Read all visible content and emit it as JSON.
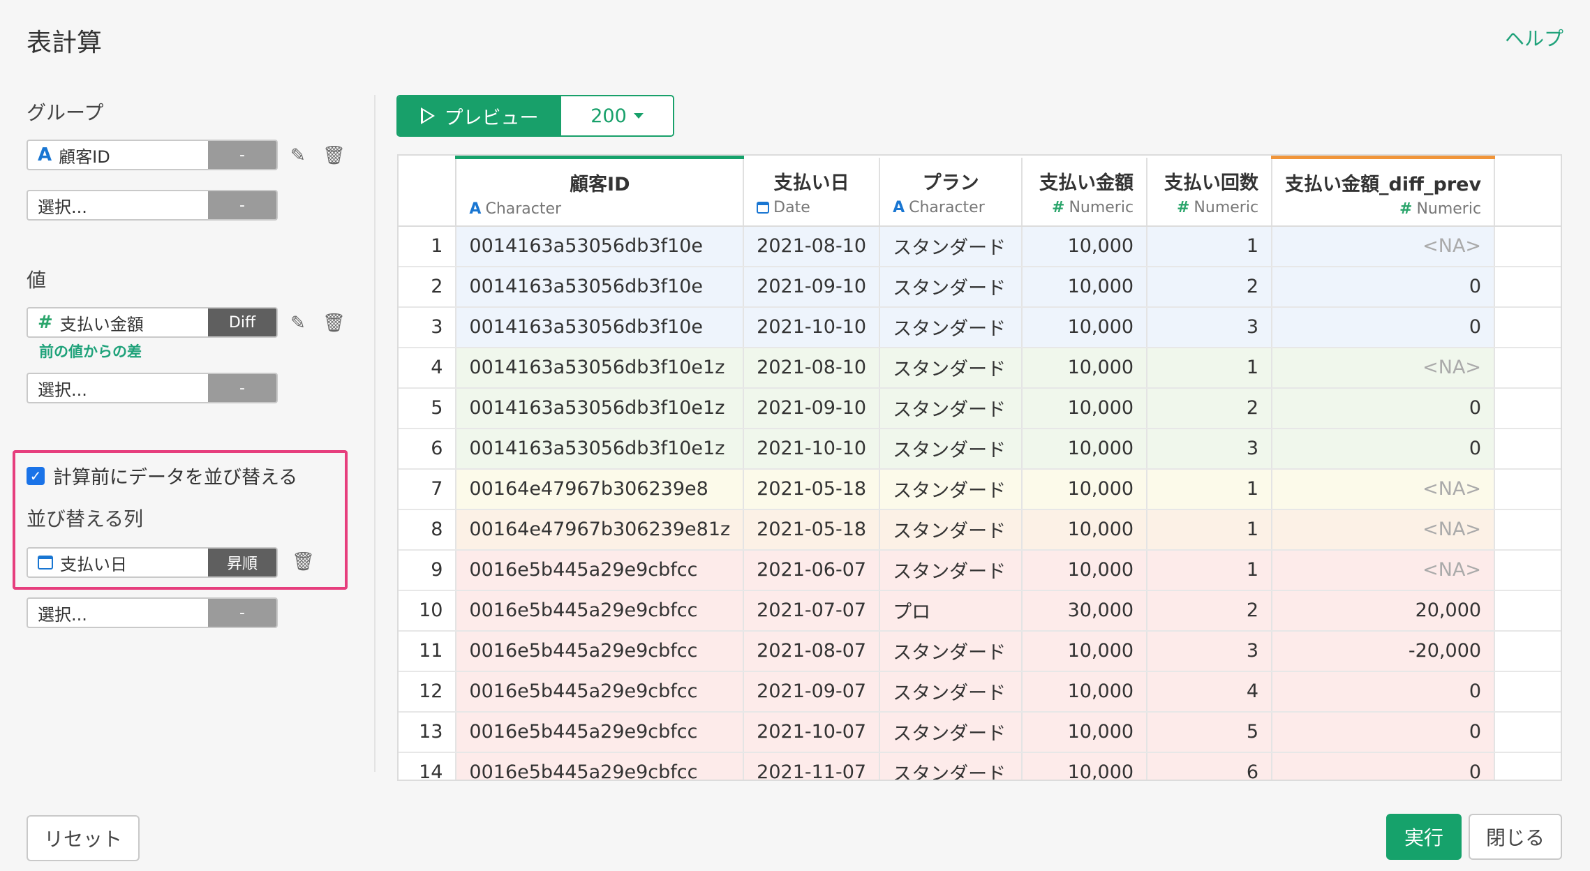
{
  "header": {
    "title": "表計算",
    "help_label": "ヘルプ"
  },
  "group": {
    "label": "グループ",
    "field1": {
      "value": "顧客ID",
      "button": "-"
    },
    "field2": {
      "value": "選択...",
      "button": "-"
    }
  },
  "value": {
    "label": "値",
    "field1": {
      "value": "支払い金額",
      "button": "Diff",
      "note": "前の値からの差"
    },
    "field2": {
      "value": "選択...",
      "button": "-"
    }
  },
  "sort": {
    "checkbox_label": "計算前にデータを並び替える",
    "checked": true,
    "columns_label": "並び替える列",
    "field1": {
      "value": "支払い日",
      "button": "昇順"
    },
    "field2": {
      "value": "選択...",
      "button": "-"
    }
  },
  "preview": {
    "button_label": "プレビュー",
    "rows_value": "200"
  },
  "table": {
    "columns": [
      {
        "name": "顧客ID",
        "type": "Character",
        "type_icon": "A"
      },
      {
        "name": "支払い日",
        "type": "Date",
        "type_icon": "calendar"
      },
      {
        "name": "プラン",
        "type": "Character",
        "type_icon": "A"
      },
      {
        "name": "支払い金額",
        "type": "Numeric",
        "type_icon": "#"
      },
      {
        "name": "支払い回数",
        "type": "Numeric",
        "type_icon": "#"
      },
      {
        "name": "支払い金額_diff_prev",
        "type": "Numeric",
        "type_icon": "#"
      }
    ],
    "rows": [
      {
        "n": "1",
        "id": "0014163a53056db3f10e",
        "date": "2021-08-10",
        "plan": "スタンダード",
        "amount": "10,000",
        "count": "1",
        "diff": "<NA>",
        "group": 1
      },
      {
        "n": "2",
        "id": "0014163a53056db3f10e",
        "date": "2021-09-10",
        "plan": "スタンダード",
        "amount": "10,000",
        "count": "2",
        "diff": "0",
        "group": 1
      },
      {
        "n": "3",
        "id": "0014163a53056db3f10e",
        "date": "2021-10-10",
        "plan": "スタンダード",
        "amount": "10,000",
        "count": "3",
        "diff": "0",
        "group": 1
      },
      {
        "n": "4",
        "id": "0014163a53056db3f10e1z",
        "date": "2021-08-10",
        "plan": "スタンダード",
        "amount": "10,000",
        "count": "1",
        "diff": "<NA>",
        "group": 2
      },
      {
        "n": "5",
        "id": "0014163a53056db3f10e1z",
        "date": "2021-09-10",
        "plan": "スタンダード",
        "amount": "10,000",
        "count": "2",
        "diff": "0",
        "group": 2
      },
      {
        "n": "6",
        "id": "0014163a53056db3f10e1z",
        "date": "2021-10-10",
        "plan": "スタンダード",
        "amount": "10,000",
        "count": "3",
        "diff": "0",
        "group": 2
      },
      {
        "n": "7",
        "id": "00164e47967b306239e8",
        "date": "2021-05-18",
        "plan": "スタンダード",
        "amount": "10,000",
        "count": "1",
        "diff": "<NA>",
        "group": 3
      },
      {
        "n": "8",
        "id": "00164e47967b306239e81z",
        "date": "2021-05-18",
        "plan": "スタンダード",
        "amount": "10,000",
        "count": "1",
        "diff": "<NA>",
        "group": 4
      },
      {
        "n": "9",
        "id": "0016e5b445a29e9cbfcc",
        "date": "2021-06-07",
        "plan": "スタンダード",
        "amount": "10,000",
        "count": "1",
        "diff": "<NA>",
        "group": 5
      },
      {
        "n": "10",
        "id": "0016e5b445a29e9cbfcc",
        "date": "2021-07-07",
        "plan": "プロ",
        "amount": "30,000",
        "count": "2",
        "diff": "20,000",
        "group": 5
      },
      {
        "n": "11",
        "id": "0016e5b445a29e9cbfcc",
        "date": "2021-08-07",
        "plan": "スタンダード",
        "amount": "10,000",
        "count": "3",
        "diff": "-20,000",
        "group": 5
      },
      {
        "n": "12",
        "id": "0016e5b445a29e9cbfcc",
        "date": "2021-09-07",
        "plan": "スタンダード",
        "amount": "10,000",
        "count": "4",
        "diff": "0",
        "group": 5
      },
      {
        "n": "13",
        "id": "0016e5b445a29e9cbfcc",
        "date": "2021-10-07",
        "plan": "スタンダード",
        "amount": "10,000",
        "count": "5",
        "diff": "0",
        "group": 5
      },
      {
        "n": "14",
        "id": "0016e5b445a29e9cbfcc",
        "date": "2021-11-07",
        "plan": "スタンダード",
        "amount": "10,000",
        "count": "6",
        "diff": "0",
        "group": 5
      }
    ]
  },
  "footer": {
    "reset_label": "リセット",
    "run_label": "実行",
    "close_label": "閉じる"
  },
  "colors": {
    "accent": "#16a26b",
    "highlight_border": "#e63e7d",
    "key_column": "#16a26b",
    "new_column": "#f0953a"
  }
}
